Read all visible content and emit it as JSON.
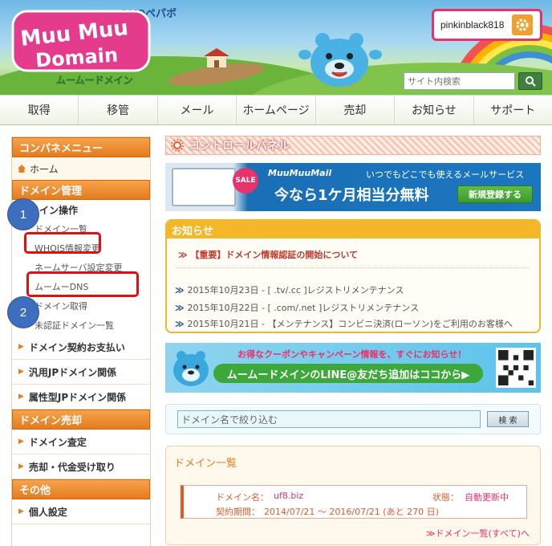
{
  "header": {
    "gmo_brand": "GMOペパボ",
    "logo_text": "MuuMuu Domain",
    "logo_sub": "ムームードメイン",
    "username": "pinkinblack818",
    "search": {
      "placeholder": "サイト内検索"
    }
  },
  "nav": {
    "items": [
      "取得",
      "移管",
      "メール",
      "ホームページ",
      "売却",
      "お知らせ",
      "サポート"
    ]
  },
  "sidebar": {
    "menu_title": "コンパネメニュー",
    "home": "ホーム",
    "domain_mgmt": "ドメイン管理",
    "domain_ops": "ドメイン操作",
    "links": [
      "ドメイン一覧",
      "WHOIS情報変更",
      "ネームサーバ設定変更",
      "ムームーDNS",
      "ドメイン取得",
      "未認証ドメイン一覧"
    ],
    "items_a": [
      "ドメイン契約お支払い",
      "汎用JPドメイン関係",
      "属性型JPドメイン関係"
    ],
    "domain_sale": "ドメイン売却",
    "items_b": [
      "ドメイン査定",
      "売却・代金受け取り"
    ],
    "other": "その他",
    "items_c": [
      "個人設定"
    ]
  },
  "main": {
    "cp_title": "コントロールパネル",
    "sale": {
      "badge": "SALE",
      "brand": "MuuMuuMail",
      "tagline": "いつでもどこでも使えるメールサービス",
      "headline": "今なら1ケ月相当分無料",
      "button": "新規登録する"
    },
    "news": {
      "title": "お知らせ",
      "important": "【重要】ドメイン情報認証の開始について",
      "items": [
        "2015年10月23日 ‐ [ .tv/.cc ]レジストリメンテナンス",
        "2015年10月22日 ‐ [ .com/.net ]レジストリメンテナンス",
        "2015年10月21日 ‐ 【メンテナンス】コンビニ決済(ローソン)をご利用のお客様へ"
      ]
    },
    "line_banner": {
      "top": "お得なクーポンやキャンペーン情報を、すぐにお知らせ！",
      "main": "ムームードメインのLINE@友だち追加はココから▶"
    },
    "filter": {
      "placeholder": "ドメイン名で絞り込む",
      "button": "検 索"
    },
    "domain_list": {
      "title": "ドメイン一覧",
      "name_label": "ドメイン名：",
      "name_value": "uf8.biz",
      "status_label": "状態：",
      "status_value": "自動更新中",
      "period_label": "契約期間：",
      "period_value": "2014/07/21 ～ 2016/07/21 (あと 270 日)",
      "all_link": "≫ドメイン一覧(すべて)へ"
    }
  },
  "annotations": {
    "marker1": "1",
    "marker2": "2"
  },
  "colors": {
    "orange": "#e67e22",
    "pink": "#e6336b",
    "highlight_red": "#e01010",
    "marker_blue": "#3e6fbf"
  }
}
